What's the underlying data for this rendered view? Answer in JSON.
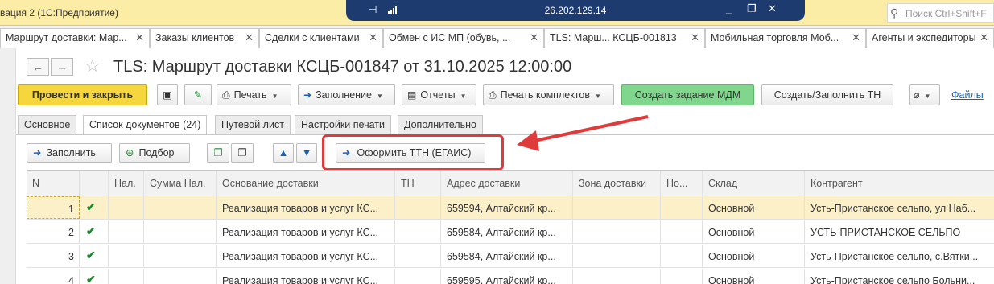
{
  "window": {
    "app_title": "вация 2  (1С:Предприятие)",
    "remote_ip": "26.202.129.14",
    "search_placeholder": "Поиск Ctrl+Shift+F"
  },
  "window_tabs": [
    {
      "label": "Маршрут доставки: Мар..."
    },
    {
      "label": "Заказы клиентов"
    },
    {
      "label": "Сделки с клиентами"
    },
    {
      "label": "Обмен с ИС МП (обувь, ..."
    },
    {
      "label": "TLS: Марш... КСЦБ-001813"
    },
    {
      "label": "Мобильная торговля Моб..."
    },
    {
      "label": "Агенты и экспедиторы"
    }
  ],
  "form": {
    "title": "TLS: Маршрут доставки КСЦБ-001847 от 31.10.2025 12:00:00"
  },
  "commands": {
    "post_close": "Провести и закрыть",
    "print": "Печать",
    "fill": "Заполнение",
    "reports": "Отчеты",
    "print_sets": "Печать комплектов",
    "create_mdm": "Создать задание МДМ",
    "create_tn": "Создать/Заполнить ТН",
    "files": "Файлы"
  },
  "form_tabs": [
    {
      "label": "Основное"
    },
    {
      "label": "Список документов (24)"
    },
    {
      "label": "Путевой лист"
    },
    {
      "label": "Настройки печати"
    },
    {
      "label": "Дополнительно"
    }
  ],
  "table_toolbar": {
    "fill": "Заполнить",
    "select": "Подбор",
    "egais": "Оформить ТТН (ЕГАИС)"
  },
  "table": {
    "columns": [
      "N",
      "",
      "Нал.",
      "Сумма Нал.",
      "Основание доставки",
      "ТН",
      "Адрес доставки",
      "Зона доставки",
      "Но...",
      "Склад",
      "Контрагент"
    ],
    "rows": [
      {
        "n": "1",
        "basis": "Реализация товаров и услуг КС...",
        "address": "659594, Алтайский кр...",
        "warehouse": "Основной",
        "counterparty": "Усть-Пристанское сельпо, ул Наб..."
      },
      {
        "n": "2",
        "basis": "Реализация товаров и услуг КС...",
        "address": "659584, Алтайский кр...",
        "warehouse": "Основной",
        "counterparty": "УСТЬ-ПРИСТАНСКОЕ СЕЛЬПО"
      },
      {
        "n": "3",
        "basis": "Реализация товаров и услуг КС...",
        "address": "659584, Алтайский кр...",
        "warehouse": "Основной",
        "counterparty": "Усть-Пристанское сельпо, с.Вятки..."
      },
      {
        "n": "4",
        "basis": "Реализация товаров и услуг КС...",
        "address": "659595, Алтайский кр...",
        "warehouse": "Основной",
        "counterparty": "Усть-Пристанское сельпо Больни..."
      }
    ]
  },
  "colors": {
    "titlebar": "#fbeda6",
    "primary_button": "#f5d63c",
    "green_button": "#7fd68c",
    "highlight": "#e03b3b",
    "link": "#1b5fb4"
  }
}
